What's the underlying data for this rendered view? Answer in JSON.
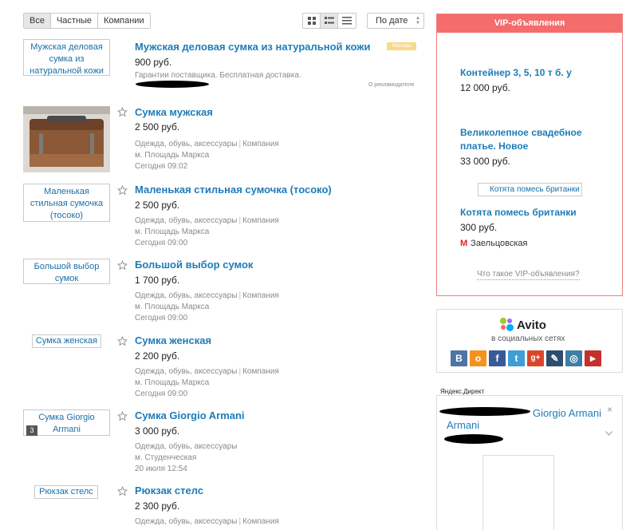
{
  "filters": {
    "tabs": [
      {
        "label": "Все",
        "active": true
      },
      {
        "label": "Частные",
        "active": false
      },
      {
        "label": "Компании",
        "active": false
      }
    ],
    "sort_label": "По дате",
    "view_modes": [
      "grid-view-icon",
      "list-view-icon",
      "compact-view-icon"
    ],
    "active_view": "list-view-icon"
  },
  "listings": [
    {
      "img_alt": "Мужская деловая сумка из натуральной кожи",
      "title": "Мужская деловая сумка из натуральной кожи",
      "price": "900 руб.",
      "note": "Гарантии поставщика. Бесплатная доставка.",
      "ad_badge": "Реклама",
      "about_advertiser": "О рекламодателе"
    },
    {
      "img_alt": "",
      "title": "Сумка мужская",
      "price": "2 500 руб.",
      "category": "Одежда, обувь, аксессуары",
      "seller": "Компания",
      "location": "м. Площадь Маркса",
      "date": "Сегодня 09:02"
    },
    {
      "img_alt": "Маленькая стильная сумочка (тосоко)",
      "title": "Маленькая стильная сумочка (тосоко)",
      "price": "2 500 руб.",
      "category": "Одежда, обувь, аксессуары",
      "seller": "Компания",
      "location": "м. Площадь Маркса",
      "date": "Сегодня 09:00"
    },
    {
      "img_alt": "Большой выбор сумок",
      "title": "Большой выбор сумок",
      "price": "1 700 руб.",
      "category": "Одежда, обувь, аксессуары",
      "seller": "Компания",
      "location": "м. Площадь Маркса",
      "date": "Сегодня 09:00"
    },
    {
      "img_alt": "Сумка женская",
      "title": "Сумка женская",
      "price": "2 200 руб.",
      "category": "Одежда, обувь, аксессуары",
      "seller": "Компания",
      "location": "м. Площадь Маркса",
      "date": "Сегодня 09:00"
    },
    {
      "img_alt": "Сумка Giorgio Armani",
      "photo_count": "3",
      "title": "Сумка Giorgio Armani",
      "price": "3 000 руб.",
      "category": "Одежда, обувь, аксессуары",
      "location": "м. Студенческая",
      "date": "20 июля 12:54"
    },
    {
      "img_alt": "Рюкзак стелс",
      "title": "Рюкзак стелс",
      "price": "2 300 руб.",
      "category": "Одежда, обувь, аксессуары",
      "seller": "Компания"
    }
  ],
  "vip": {
    "header": "VIP-объявления",
    "items": [
      {
        "title": "Контейнер 3, 5, 10 т б. у",
        "price": "12 000 руб."
      },
      {
        "title": "Великолепное свадебное платье. Новое",
        "price": "33 000 руб."
      },
      {
        "img_alt": "Котята помесь британки",
        "title": "Котята помесь британки",
        "price": "300 руб.",
        "metro": "Заельцовская"
      }
    ],
    "what_is": "Что такое VIP-объявления?"
  },
  "avito_social": {
    "brand": "Avito",
    "subtitle": "в социальных сетях",
    "networks": [
      {
        "icon": "vk-icon",
        "glyph": "В",
        "color": "#4c75a3"
      },
      {
        "icon": "odnoklassniki-icon",
        "glyph": "о",
        "color": "#f5921e"
      },
      {
        "icon": "facebook-icon",
        "glyph": "f",
        "color": "#3b5998"
      },
      {
        "icon": "twitter-icon",
        "glyph": "t",
        "color": "#3f9ed6"
      },
      {
        "icon": "google-plus-icon",
        "glyph": "g+",
        "color": "#d9472b"
      },
      {
        "icon": "livejournal-icon",
        "glyph": "✎",
        "color": "#2d4e6e"
      },
      {
        "icon": "instagram-icon",
        "glyph": "◎",
        "color": "#3d7fa8"
      },
      {
        "icon": "youtube-icon",
        "glyph": "▶",
        "color": "#c4302b"
      }
    ]
  },
  "yandex_direct": {
    "label": "Яндекс.Директ",
    "ad_text": "Giorgio Armani"
  },
  "colors": {
    "link": "#1e7cb8",
    "vip_header": "#f46c6c",
    "metro": "#e31e24"
  }
}
